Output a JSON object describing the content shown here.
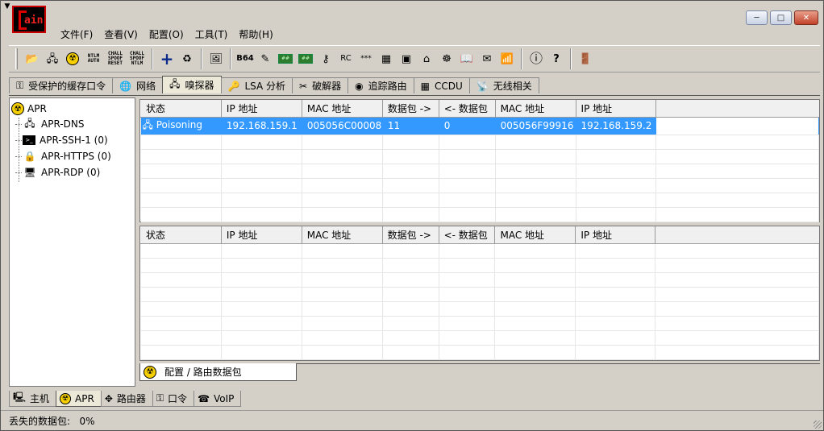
{
  "window": {
    "app_logo_text": "ain",
    "sysmenu_glyph": "▼",
    "controls": {
      "minimize": "─",
      "maximize": "□",
      "close": "✕"
    }
  },
  "menubar": [
    {
      "label": "文件(F)"
    },
    {
      "label": "查看(V)"
    },
    {
      "label": "配置(O)"
    },
    {
      "label": "工具(T)"
    },
    {
      "label": "帮助(H)"
    }
  ],
  "toolbar": {
    "ntlm_auth": "NTLM\nAUTH",
    "chall_spoof_reset": "CHALL\nSPOOF\nRESET",
    "chall_spoof_ntlm": "CHALL\nSPOOF\nNTLM",
    "b64": "B64",
    "stars": "***"
  },
  "main_tabs": [
    {
      "label": "受保护的缓存口令",
      "icon": "key-icon"
    },
    {
      "label": "网络",
      "icon": "network-icon"
    },
    {
      "label": "嗅探器",
      "icon": "sniffer-icon",
      "active": true
    },
    {
      "label": "LSA 分析",
      "icon": "lsa-icon"
    },
    {
      "label": "破解器",
      "icon": "cracker-icon"
    },
    {
      "label": "追踪路由",
      "icon": "traceroute-icon"
    },
    {
      "label": "CCDU",
      "icon": "ccdu-icon"
    },
    {
      "label": "无线相关",
      "icon": "wireless-icon"
    }
  ],
  "tree": {
    "root": "APR",
    "children": [
      {
        "label": "APR-DNS"
      },
      {
        "label": "APR-SSH-1 (0)"
      },
      {
        "label": "APR-HTTPS (0)"
      },
      {
        "label": "APR-RDP (0)"
      }
    ]
  },
  "top_table": {
    "headers": [
      "状态",
      "IP 地址",
      "MAC 地址",
      "数据包 ->",
      "<- 数据包",
      "MAC 地址",
      "IP 地址"
    ],
    "rows": [
      [
        "Poisoning",
        "192.168.159.1",
        "005056C00008",
        "11",
        "0",
        "005056F99916",
        "192.168.159.2"
      ]
    ]
  },
  "bottom_table": {
    "headers": [
      "状态",
      "IP 地址",
      "MAC 地址",
      "数据包 ->",
      "<- 数据包",
      "MAC 地址",
      "IP 地址"
    ],
    "rows": []
  },
  "sub_tab": {
    "label": "配置 / 路由数据包"
  },
  "bottom_tabs": [
    {
      "label": "主机",
      "icon": "computer-icon"
    },
    {
      "label": "APR",
      "icon": "radiation-icon",
      "active": true
    },
    {
      "label": "路由器",
      "icon": "router-icon"
    },
    {
      "label": "口令",
      "icon": "password-icon"
    },
    {
      "label": "VoIP",
      "icon": "voip-icon"
    }
  ],
  "status": {
    "text": "丢失的数据包:   0%"
  },
  "colors": {
    "selection": "#3399ff",
    "logo_red": "#dd2222"
  }
}
